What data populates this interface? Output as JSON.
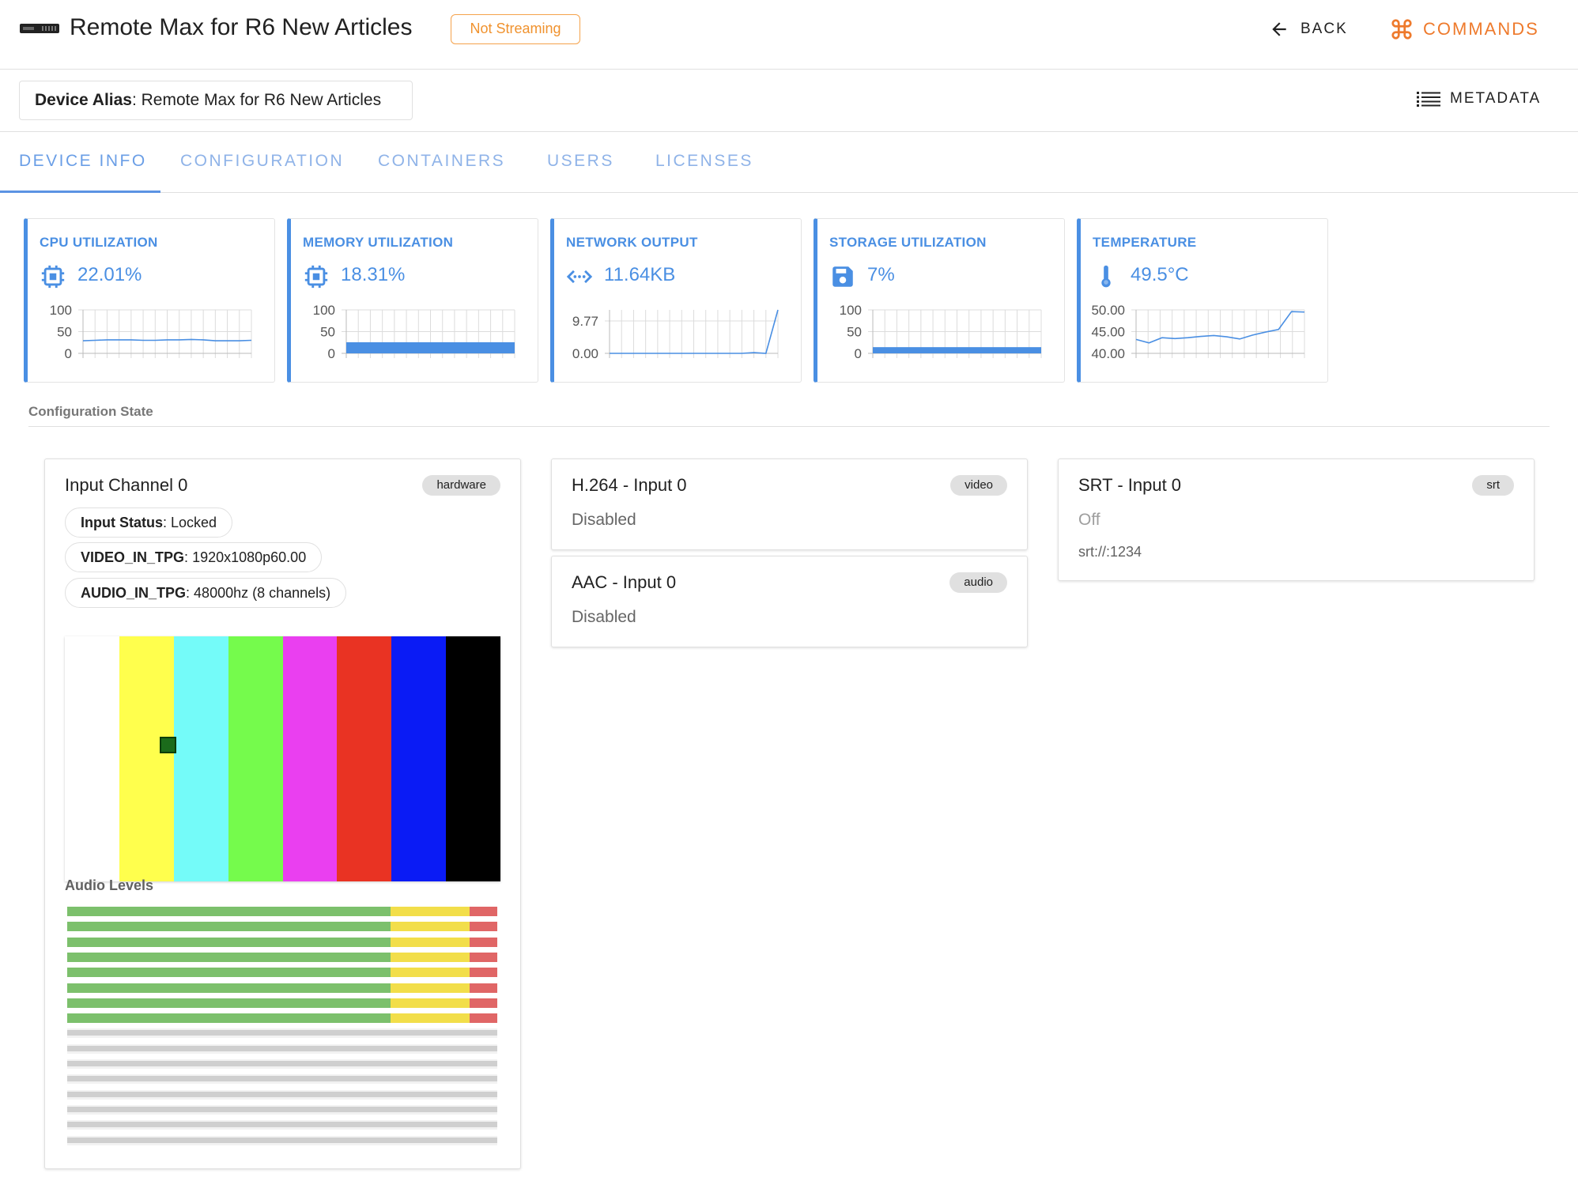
{
  "header": {
    "title": "Remote Max for R6 New Articles",
    "status": "Not Streaming",
    "back_label": "BACK",
    "commands_label": "COMMANDS",
    "icons": {
      "device": "device-hardware-icon",
      "back": "arrow-left-icon",
      "commands": "command-key-icon"
    }
  },
  "alias": {
    "label": "Device Alias",
    "value": "Remote Max for R6 New Articles",
    "metadata_label": "METADATA"
  },
  "tabs": [
    {
      "label": "DEVICE INFO",
      "active": true
    },
    {
      "label": "CONFIGURATION"
    },
    {
      "label": "CONTAINERS"
    },
    {
      "label": "USERS"
    },
    {
      "label": "LICENSES"
    }
  ],
  "stats": [
    {
      "title": "CPU UTILIZATION",
      "value": "22.01%",
      "icon": "cpu-chip-icon",
      "chart_data": {
        "type": "line",
        "ylim": [
          0,
          100
        ],
        "y_ticks": [
          "100",
          "50",
          "0"
        ],
        "grid": true,
        "values": [
          29,
          30,
          31,
          31,
          31,
          30,
          30,
          31,
          31,
          32,
          31,
          29,
          29,
          29,
          30
        ]
      }
    },
    {
      "title": "MEMORY UTILIZATION",
      "value": "18.31%",
      "icon": "memory-chip-icon",
      "chart_data": {
        "type": "area",
        "ylim": [
          0,
          100
        ],
        "y_ticks": [
          "100",
          "50",
          "0"
        ],
        "grid": true,
        "values": [
          18.3,
          18.3,
          18.3,
          18.3,
          18.3,
          18.3,
          18.3,
          18.3,
          18.3,
          18.3,
          18.3,
          18.3,
          18.3,
          18.3,
          18.3
        ]
      }
    },
    {
      "title": "NETWORK OUTPUT",
      "value": "11.64KB",
      "icon": "network-code-icon",
      "chart_data": {
        "type": "line",
        "ylim": [
          0,
          11.64
        ],
        "y_ticks": [
          "9.77",
          "0.00"
        ],
        "grid": true,
        "values": [
          0,
          0,
          0,
          0,
          0,
          0,
          0,
          0,
          0,
          0,
          0,
          0,
          0.2,
          0,
          11.64
        ]
      }
    },
    {
      "title": "STORAGE UTILIZATION",
      "value": "7%",
      "icon": "floppy-disk-icon",
      "chart_data": {
        "type": "area",
        "ylim": [
          0,
          100
        ],
        "y_ticks": [
          "100",
          "50",
          "0"
        ],
        "grid": true,
        "values": [
          7,
          7,
          7,
          7,
          7,
          7,
          7,
          7,
          7,
          7,
          7,
          7,
          7,
          7,
          7
        ]
      }
    },
    {
      "title": "TEMPERATURE",
      "value": "49.5°C",
      "icon": "thermometer-icon",
      "chart_data": {
        "type": "line",
        "ylim": [
          40,
          50
        ],
        "y_ticks": [
          "50.00",
          "45.00",
          "40.00"
        ],
        "grid": true,
        "values": [
          43.2,
          42.4,
          43.6,
          43.4,
          43.6,
          43.9,
          44.1,
          43.8,
          43.3,
          44.2,
          44.9,
          45.5,
          49.6,
          49.5
        ]
      }
    }
  ],
  "section_title": "Configuration State",
  "input_channel": {
    "title": "Input Channel 0",
    "tag": "hardware",
    "status_items": [
      {
        "label": "Input Status",
        "value": "Locked"
      },
      {
        "label": "VIDEO_IN_TPG",
        "value": "1920x1080p60.00"
      },
      {
        "label": "AUDIO_IN_TPG",
        "value": "48000hz (8 channels)"
      }
    ],
    "color_bars": [
      "#ffffff",
      "#ffff4d",
      "#74fbf9",
      "#75fb4c",
      "#ea3ff0",
      "#e93323",
      "#0a1bf5",
      "#000000"
    ],
    "audio_title": "Audio Levels",
    "audio_meters": {
      "active": 8,
      "inactive": 8,
      "level": 1.0
    }
  },
  "h264": {
    "title": "H.264 - Input 0",
    "tag": "video",
    "status": "Disabled"
  },
  "aac": {
    "title": "AAC - Input 0",
    "tag": "audio",
    "status": "Disabled"
  },
  "srt": {
    "title": "SRT - Input 0",
    "tag": "srt",
    "status": "Off",
    "url": "srt://:1234"
  },
  "colors": {
    "accent": "#4a8fe3",
    "warning": "#f0922e",
    "commands": "#ee7a2c",
    "tab": "#8fb3e8"
  }
}
